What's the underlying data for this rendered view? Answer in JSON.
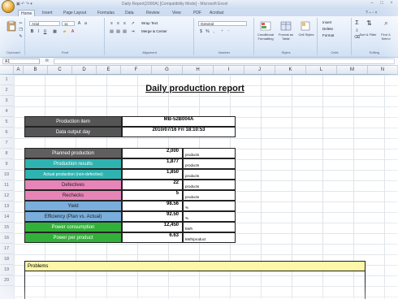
{
  "window": {
    "title": "Daily Report(2000A) [Compatibility Mode] - Microsoft Excel",
    "office_button": "office-button",
    "controls": [
      "–",
      "□",
      "×"
    ]
  },
  "ribbon": {
    "tabs": [
      "Home",
      "Insert",
      "Page Layout",
      "Formulas",
      "Data",
      "Review",
      "View",
      "PDF",
      "Acrobat"
    ],
    "active_tab": "Home",
    "font_name": "Arial",
    "font_size": "11",
    "wrap_text": "Wrap Text",
    "merge_center": "Merge & Center",
    "number_format": "General",
    "conditional_formatting": "Conditional Formatting",
    "format_as_table": "Format as Table",
    "cell_styles": "Cell Styles",
    "insert": "Insert",
    "delete": "Delete",
    "format": "Format",
    "sort_filter": "Sort & Filter",
    "find_select": "Find & Select",
    "groups": [
      "Clipboard",
      "Font",
      "Alignment",
      "Number",
      "Styles",
      "Cells",
      "Editing"
    ]
  },
  "formula_bar": {
    "name_box": "A1",
    "fx": "fx",
    "value": ""
  },
  "columns": [
    "A",
    "B",
    "C",
    "D",
    "E",
    "F",
    "G",
    "H",
    "I",
    "J",
    "K",
    "L",
    "M",
    "N"
  ],
  "rows": [
    "1",
    "2",
    "3",
    "4",
    "5",
    "6",
    "7",
    "8",
    "9",
    "10",
    "11",
    "12",
    "13",
    "14",
    "15",
    "16",
    "17",
    "18",
    "19",
    "20"
  ],
  "report": {
    "title": "Daily production report",
    "header": [
      {
        "label": "Production item",
        "value": "MB-52B004A",
        "color": "#555555"
      },
      {
        "label": "Data output day",
        "value": "2010/07/16 Fri 18:10:53",
        "color": "#555555"
      }
    ],
    "metrics": [
      {
        "label": "Planned production",
        "value": "2,000",
        "unit": "products",
        "color": "#5f5f5f"
      },
      {
        "label": "Production results",
        "value": "1,877",
        "unit": "products",
        "color": "#2fb3b0"
      },
      {
        "label": "Actual production (non-defective)",
        "value": "1,850",
        "unit": "products",
        "color": "#2fb3b0"
      },
      {
        "label": "Defectives",
        "value": "22",
        "unit": "products",
        "color": "#e784b8"
      },
      {
        "label": "Rechecks",
        "value": "5",
        "unit": "products",
        "color": "#e784b8"
      },
      {
        "label": "Yield",
        "value": "98.56",
        "unit": "%",
        "color": "#7aaedc"
      },
      {
        "label": "Efficiency (Plan vs. Actual)",
        "value": "92.50",
        "unit": "%",
        "color": "#7aaedc"
      },
      {
        "label": "Power consumption",
        "value": "12,450",
        "unit": "kWh",
        "color": "#33b03a"
      },
      {
        "label": "Power per product",
        "value": "6.63",
        "unit": "kWh/product",
        "color": "#33b03a"
      }
    ],
    "problems_label": "Problems"
  }
}
